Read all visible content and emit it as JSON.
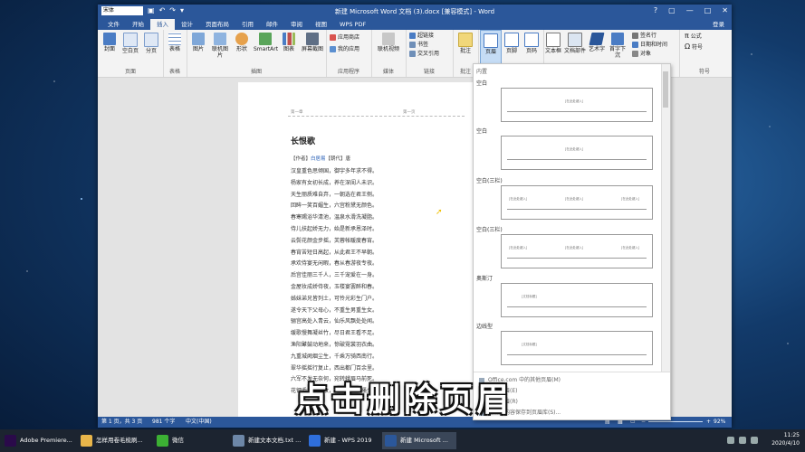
{
  "window": {
    "title": "新建 Microsoft Word 文档 (3).docx [兼容模式] - Word",
    "font_box": "宋体",
    "controls": [
      "?",
      "▢",
      "—",
      "□",
      "✕"
    ]
  },
  "tabs": [
    {
      "label": "文件",
      "kind": "file"
    },
    {
      "label": "开始"
    },
    {
      "label": "插入",
      "active": true
    },
    {
      "label": "设计"
    },
    {
      "label": "页面布局"
    },
    {
      "label": "引用"
    },
    {
      "label": "邮件"
    },
    {
      "label": "审阅"
    },
    {
      "label": "视图"
    },
    {
      "label": "WPS PDF"
    }
  ],
  "signin": "登录",
  "ribbon": {
    "pages": {
      "label": "页面",
      "buttons": [
        "封面",
        "空白页",
        "分页"
      ]
    },
    "tables": {
      "label": "表格",
      "buttons": [
        "表格"
      ]
    },
    "illustrations": {
      "label": "插图",
      "buttons": [
        "图片",
        "联机图片",
        "形状",
        "SmartArt",
        "图表",
        "屏幕截图"
      ]
    },
    "apps": {
      "label": "应用程序",
      "items": [
        "应用商店",
        "我的应用"
      ]
    },
    "media": {
      "label": "媒体",
      "buttons": [
        "联机视频"
      ]
    },
    "links": {
      "label": "链接",
      "items": [
        "超链接",
        "书签",
        "交叉引用"
      ]
    },
    "comments": {
      "label": "批注",
      "buttons": [
        "批注"
      ]
    },
    "header_footer": {
      "buttons": [
        "页眉",
        "页脚",
        "页码"
      ]
    },
    "text": {
      "buttons": [
        "文本框",
        "文档部件",
        "艺术字",
        "首字下沉"
      ],
      "items": [
        "签名行",
        "日期和时间",
        "对象"
      ]
    },
    "symbols": {
      "label": "符号",
      "items": [
        "公式",
        "符号"
      ]
    }
  },
  "document": {
    "header_left": "第一章",
    "header_right": "第一页",
    "title": "长恨歌",
    "byline_prefix": "【作者】",
    "author": "白居易",
    "byline_suffix": "【朝代】唐",
    "lines": [
      "汉皇重色思倾国，御宇多年求不得。",
      "杨家有女初长成，养在深闺人未识。",
      "天生丽质难自弃，一朝选在君王侧。",
      "回眸一笑百媚生，六宫粉黛无颜色。",
      "春寒赐浴华清池，温泉水滑洗凝脂。",
      "侍儿扶起娇无力，始是新承恩泽时。",
      "云鬓花颜金步摇，芙蓉帐暖度春宵。",
      "春宵苦短日高起，从此君王不早朝。",
      "承欢侍宴无闲暇，春从春游夜专夜。",
      "后宫佳丽三千人，三千宠爱在一身。",
      "金屋妆成娇侍夜，玉楼宴罢醉和春。",
      "姊妹弟兄皆列土，可怜光彩生门户。",
      "遂令天下父母心，不重生男重生女。",
      "骊宫高处入青云，仙乐风飘处处闻。",
      "缓歌慢舞凝丝竹，尽日君王看不足。",
      "渔阳鼙鼓动地来，惊破霓裳羽衣曲。",
      "九重城阙烟尘生，千乘万骑西南行。",
      "翠华摇摇行复止，西出都门百余里。",
      "六军不发无奈何，宛转蛾眉马前死。",
      "花钿委地无人收，翠翘金雀玉搔头。"
    ]
  },
  "gallery": {
    "section": "内置",
    "items": [
      {
        "label": "空白",
        "placeholder": "[在此处键入]"
      },
      {
        "label": "空白",
        "placeholder": "[在此处键入]"
      },
      {
        "label": "空白(三栏)",
        "placeholder": "[在此处键入]"
      },
      {
        "label": "空白(三栏)",
        "placeholder": "[在此处键入]"
      },
      {
        "label": "奥斯汀",
        "placeholder": "[文档标题]"
      },
      {
        "label": "边线型",
        "placeholder": "[文档标题]"
      }
    ],
    "footer_items": [
      "Office.com 中的其他页眉(M)",
      "编辑页眉(E)",
      "删除页眉(R)",
      "将所选内容保存到页眉库(S)..."
    ]
  },
  "status": {
    "page": "第 1 页，共 3 页",
    "words": "981 个字",
    "lang": "中文(中国)",
    "zoom": "92%"
  },
  "caption": "点击删除页眉",
  "taskbar": {
    "items": [
      {
        "label": "Adobe Premiere...",
        "color": "#2a0a4a"
      },
      {
        "label": "怎样用卷毛梳刷...",
        "color": "#e8b54a"
      },
      {
        "label": "微信",
        "color": "#3cb034"
      },
      {
        "label": "新建文本文档.txt ...",
        "color": "#6d87a8"
      },
      {
        "label": "新建 - WPS 2019",
        "color": "#2f6fdc"
      },
      {
        "label": "新建 Microsoft ...",
        "color": "#2b579a"
      }
    ],
    "time": "11:25",
    "date": "2020/4/10"
  },
  "colors": {
    "word_blue": "#2b579a",
    "caption_text": "#ffffff"
  }
}
